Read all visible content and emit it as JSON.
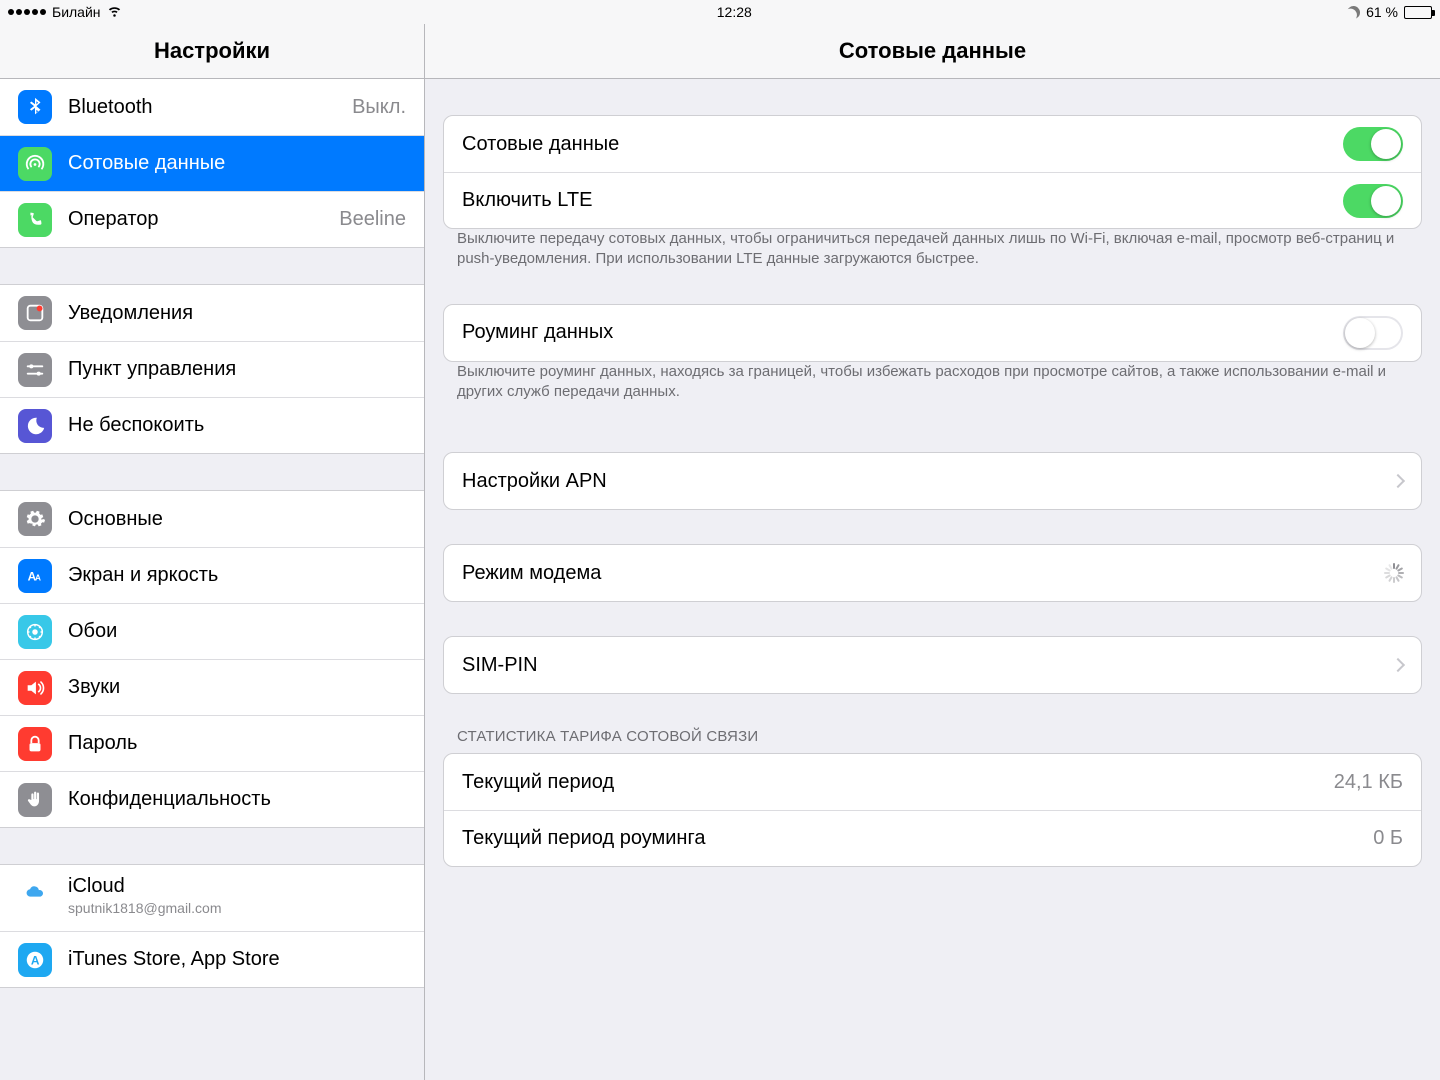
{
  "status": {
    "carrier": "Билайн",
    "time": "12:28",
    "battery_pct": "61 %",
    "battery_fill": 61
  },
  "sidebar": {
    "title": "Настройки",
    "g0": [
      {
        "label": "Bluetooth",
        "value": "Выкл."
      },
      {
        "label": "Сотовые данные",
        "selected": true
      },
      {
        "label": "Оператор",
        "value": "Beeline"
      }
    ],
    "g1": [
      {
        "label": "Уведомления"
      },
      {
        "label": "Пункт управления"
      },
      {
        "label": "Не беспокоить"
      }
    ],
    "g2": [
      {
        "label": "Основные"
      },
      {
        "label": "Экран и яркость"
      },
      {
        "label": "Обои"
      },
      {
        "label": "Звуки"
      },
      {
        "label": "Пароль"
      },
      {
        "label": "Конфиденциальность"
      }
    ],
    "g3": [
      {
        "label": "iCloud",
        "sub": "sputnik1818@gmail.com"
      },
      {
        "label": "iTunes Store, App Store"
      }
    ]
  },
  "detail": {
    "title": "Сотовые данные",
    "sw_cellular": "Сотовые данные",
    "sw_lte": "Включить LTE",
    "note1": "Выключите передачу сотовых данных, чтобы ограничиться передачей данных лишь по Wi-Fi, включая e-mail, просмотр веб-страниц и push-уведомления. При использовании LTE данные загружаются быстрее.",
    "sw_roaming": "Роуминг данных",
    "note2": "Выключите роуминг данных, находясь за границей, чтобы избежать расходов при просмотре сайтов, а также использовании e-mail и других служб передачи данных.",
    "apn": "Настройки APN",
    "hotspot": "Режим модема",
    "sim": "SIM-PIN",
    "stats_header": "СТАТИСТИКА ТАРИФА СОТОВОЙ СВЯЗИ",
    "current_period": "Текущий период",
    "current_period_val": "24,1 КБ",
    "roaming_period": "Текущий период роуминга",
    "roaming_period_val": "0 Б"
  }
}
